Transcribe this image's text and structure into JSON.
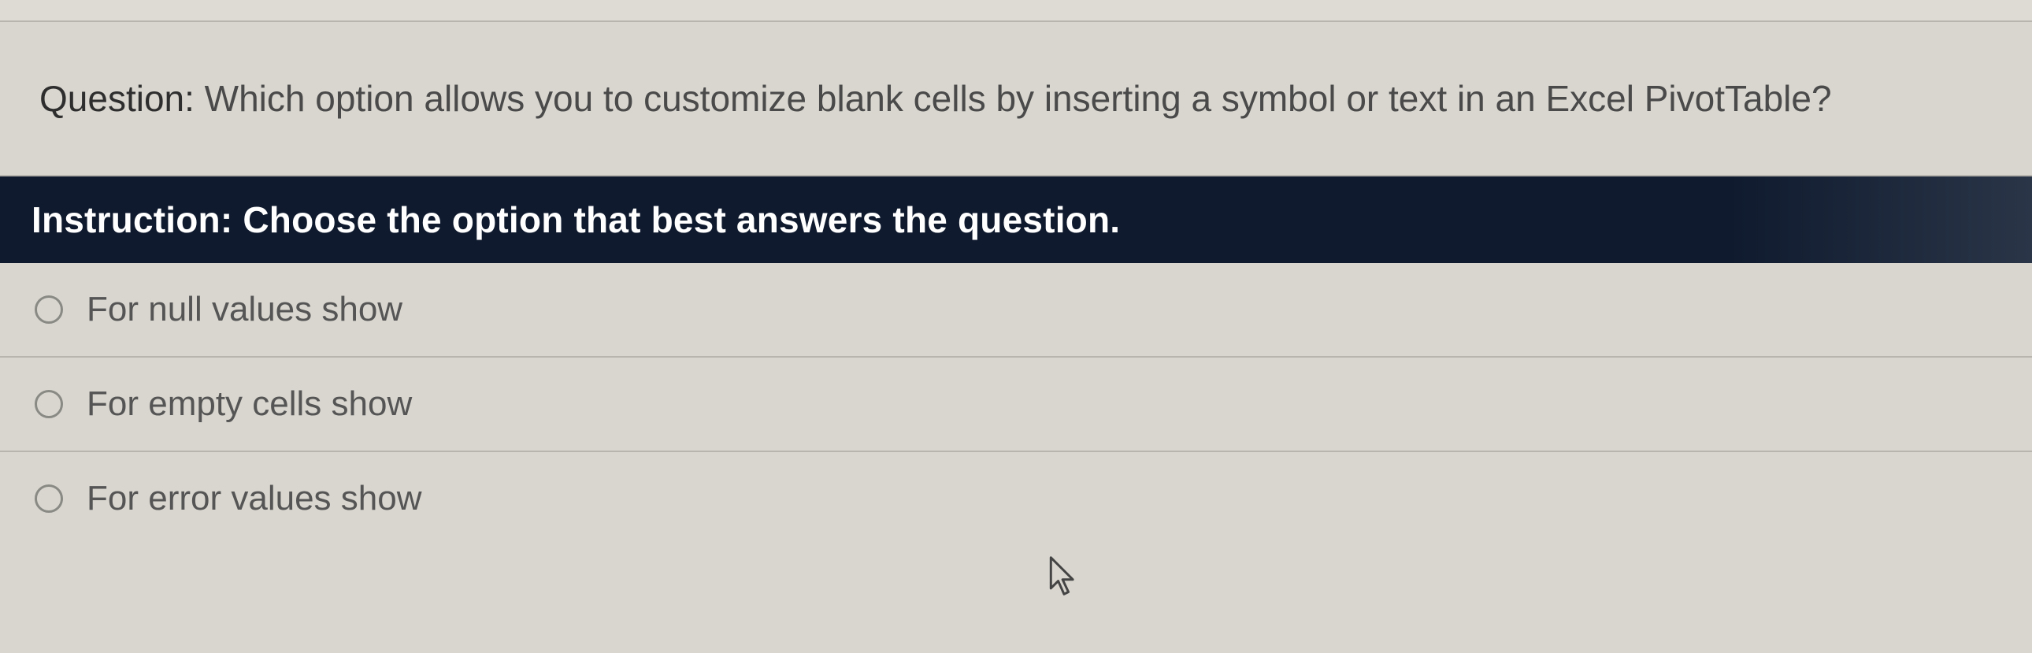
{
  "question": {
    "label": "Question:",
    "text": " Which option allows you to customize blank cells by inserting a symbol or text in an Excel PivotTable?"
  },
  "instruction": {
    "label": "Instruction: ",
    "text": "Choose the option that best answers the question."
  },
  "options": [
    {
      "label": "For null values show"
    },
    {
      "label": "For empty cells show"
    },
    {
      "label": "For error values show"
    }
  ]
}
